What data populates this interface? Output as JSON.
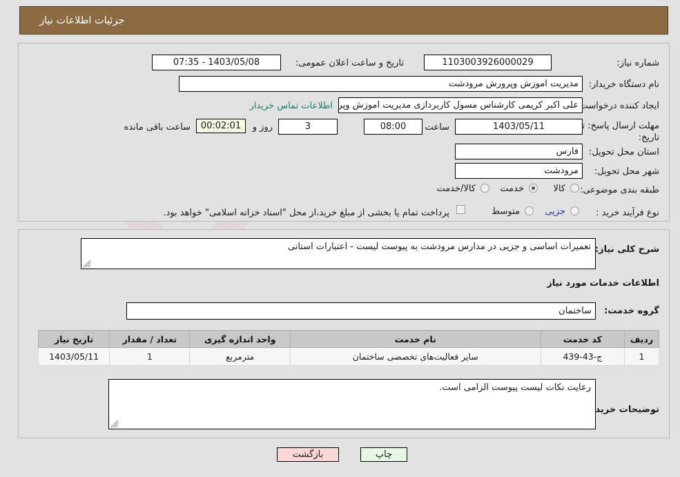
{
  "header": {
    "title": "جزئیات اطلاعات نیاز"
  },
  "watermark": {
    "text": "AriaTender.net"
  },
  "top_panel": {
    "need_number_label": "شماره نیاز:",
    "need_number_value": "1103003926000029",
    "announce_label": "تاریخ و ساعت اعلان عمومی:",
    "announce_value": "1403/05/08 - 07:35",
    "buyer_org_label": "نام دستگاه خریدار:",
    "buyer_org_value": "مدیریت اموزش وپرورش مرودشت",
    "creator_label": "ایجاد کننده درخواست:",
    "creator_value": "علی اکبر کریمی کارشناس مسول کاربردازی مدیریت اموزش وپرورش مرودشت",
    "contact_link": "اطلاعات تماس خریدار",
    "deadline_label_line1": "مهلت ارسال پاسخ: تا",
    "deadline_label_line2": "تاریخ:",
    "deadline_date": "1403/05/11",
    "hour_label": "ساعت",
    "deadline_time": "08:00",
    "days_left": "3",
    "days_and_label": "روز و",
    "countdown": "00:02:01",
    "remaining_label": "ساعت باقی مانده",
    "province_label": "استان محل تحویل:",
    "province_value": "فارس",
    "city_label": "شهر محل تحویل:",
    "city_value": "مرودشت",
    "category_label": "طبقه بندی موضوعی:",
    "category_options": [
      {
        "label": "کالا",
        "selected": false
      },
      {
        "label": "خدمت",
        "selected": true
      },
      {
        "label": "کالا/خدمت",
        "selected": false
      }
    ],
    "process_label": "نوع فرآیند خرید :",
    "process_options": [
      {
        "label": "جزیی",
        "selected": false
      },
      {
        "label": "متوسط",
        "selected": false
      }
    ],
    "treasury_checkbox_checked": false,
    "treasury_note": "پرداخت تمام یا بخشی از مبلغ خرید،از محل \"اسناد خزانه اسلامی\" خواهد بود."
  },
  "bottom_panel": {
    "summary_label": "شرح کلی نیاز:",
    "summary_value": "تعمیرات اساسی و جزیی در مدارس مرودشت به پیوست لیست - اعتبارات استانی",
    "services_heading": "اطلاعات خدمات مورد نیاز",
    "service_group_label": "گروه خدمت:",
    "service_group_value": "ساختمان",
    "table": {
      "columns": [
        "ردیف",
        "کد خدمت",
        "نام خدمت",
        "واحد اندازه گیری",
        "تعداد / مقدار",
        "تاریخ نیاز"
      ],
      "rows": [
        [
          "1",
          "ج-43-439",
          "سایر فعالیت‌های تخصصی ساختمان",
          "مترمربع",
          "1",
          "1403/05/11"
        ]
      ]
    },
    "buyer_notes_label": "توضیحات خریدار:",
    "buyer_notes_value": "رعایت نکات لیست پیوست الزامی است."
  },
  "footer": {
    "print_label": "چاپ",
    "back_label": "بازگشت"
  },
  "colors": {
    "header_bg": "#8c6a42",
    "page_bg": "#e2e2e2",
    "link": "#1f7a6d",
    "countdown_bg": "#f7f6e0",
    "print_bg": "#e8f7e4",
    "back_bg": "#fbd7d7",
    "table_header_bg": "#c7c7c7"
  }
}
